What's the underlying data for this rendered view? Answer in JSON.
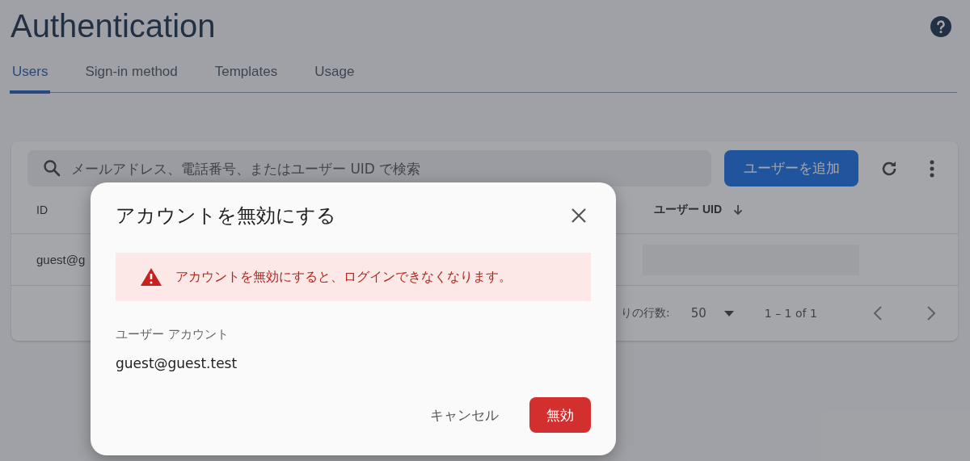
{
  "header": {
    "title": "Authentication"
  },
  "tabs": [
    {
      "label": "Users",
      "selected": true
    },
    {
      "label": "Sign-in method",
      "selected": false
    },
    {
      "label": "Templates",
      "selected": false
    },
    {
      "label": "Usage",
      "selected": false
    }
  ],
  "toolbar": {
    "search": {
      "placeholder": "メールアドレス、電話番号、またはユーザー UID で検索"
    },
    "add_button": "ユーザーを追加"
  },
  "table": {
    "columns": [
      "ID",
      "ユーザー UID"
    ],
    "rows": [
      {
        "id": "guest@g"
      }
    ],
    "pagination": {
      "rows_per_page_label": "りの行数:",
      "rows_per_page": "50",
      "range": "1 – 1 of 1"
    }
  },
  "dialog": {
    "title": "アカウントを無効にする",
    "warning": "アカウントを無効にすると、ログインできなくなります。",
    "field_label": "ユーザー アカウント",
    "field_value": "guest@guest.test",
    "buttons": [
      {
        "label": "キャンセル",
        "kind": "text"
      },
      {
        "label": "無効",
        "kind": "danger"
      }
    ]
  }
}
